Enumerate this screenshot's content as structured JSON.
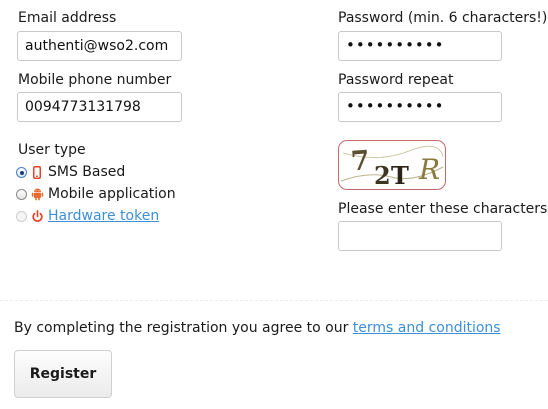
{
  "form": {
    "email": {
      "label": "Email address",
      "value": "authenti@wso2.com"
    },
    "mobile": {
      "label": "Mobile phone number",
      "value": "0094773131798"
    },
    "password": {
      "label": "Password (min. 6 characters!)",
      "value": "••••••••••"
    },
    "password_repeat": {
      "label": "Password repeat",
      "value": "••••••••••"
    },
    "user_type": {
      "label": "User type",
      "selected": "SMS Based",
      "options": [
        {
          "label": "SMS Based",
          "icon": "mobile-phone-icon",
          "checked": true,
          "disabled": false,
          "link": false
        },
        {
          "label": "Mobile application",
          "icon": "android-icon",
          "checked": false,
          "disabled": false,
          "link": false
        },
        {
          "label": "Hardware token",
          "icon": "power-icon",
          "checked": false,
          "disabled": true,
          "link": true
        }
      ]
    },
    "captcha": {
      "text": "72TR",
      "prompt": "Please enter these characters",
      "input_value": ""
    }
  },
  "footer": {
    "agreement_text": "By completing the registration you agree to our",
    "terms_link": "terms and conditions",
    "register_label": "Register"
  },
  "colors": {
    "link": "#3d8fd6",
    "captcha_border": "#c96a6a",
    "icon_red": "#e0452b",
    "icon_orange": "#e8692e",
    "radio_checked": "#1e3e78"
  }
}
